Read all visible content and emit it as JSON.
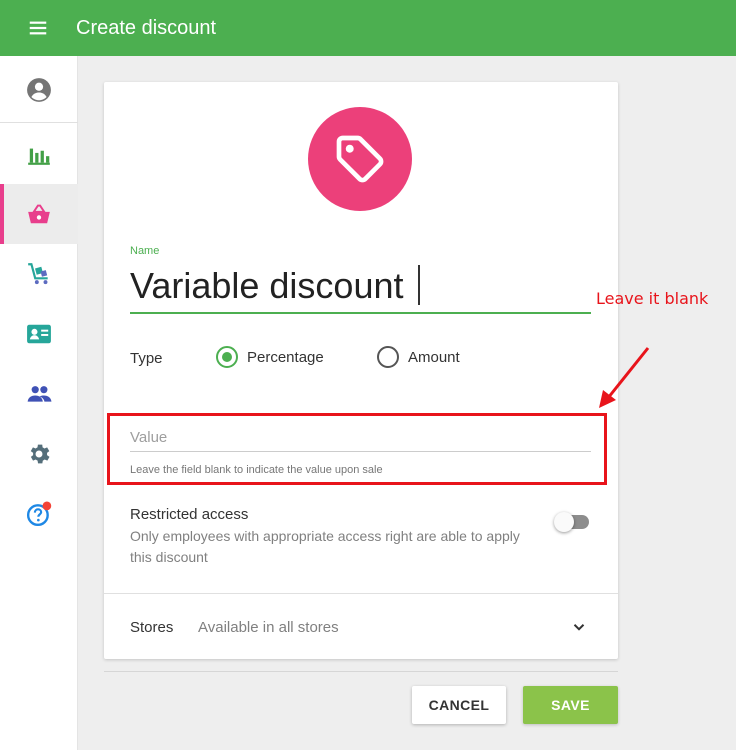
{
  "header": {
    "title": "Create discount",
    "menu_icon": "menu-icon"
  },
  "sidebar": {
    "items": [
      {
        "icon": "account-icon",
        "active": false
      },
      {
        "icon": "reports-icon",
        "active": false
      },
      {
        "icon": "items-basket-icon",
        "active": true
      },
      {
        "icon": "inventory-cart-icon",
        "active": false
      },
      {
        "icon": "customers-card-icon",
        "active": false
      },
      {
        "icon": "employees-icon",
        "active": false
      },
      {
        "icon": "settings-icon",
        "active": false
      },
      {
        "icon": "help-icon",
        "active": false,
        "notification_dot": true
      }
    ]
  },
  "form": {
    "icon": "discount-tag-icon",
    "name_label": "Name",
    "name_value": "Variable discount",
    "type_label": "Type",
    "type_options": [
      {
        "label": "Percentage",
        "checked": true
      },
      {
        "label": "Amount",
        "checked": false
      }
    ],
    "value_placeholder": "Value",
    "value_value": "",
    "value_hint": "Leave the field blank to indicate the value upon sale",
    "restricted_title": "Restricted access",
    "restricted_desc": "Only employees with appropriate access right are able to apply this discount",
    "restricted_enabled": false,
    "stores_label": "Stores",
    "stores_value": "Available in all stores"
  },
  "actions": {
    "cancel_label": "CANCEL",
    "save_label": "SAVE"
  },
  "annotation": {
    "text": "Leave it blank"
  },
  "colors": {
    "appbar": "#4caf50",
    "accent_pink": "#ec407a",
    "save_button": "#8bc34a",
    "annotation_red": "#e8141b"
  }
}
